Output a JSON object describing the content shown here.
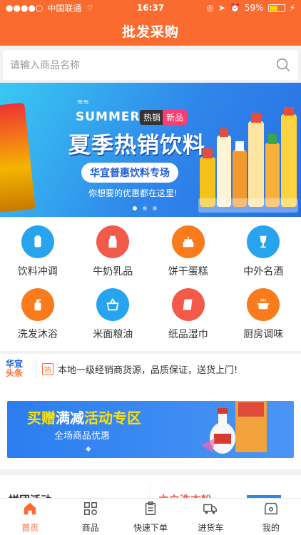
{
  "status_bar": {
    "carrier": "中国联通",
    "time": "16:37",
    "battery": "59%",
    "battery_level": 0.59
  },
  "header": {
    "title": "批发采购"
  },
  "search": {
    "placeholder": "请输入商品名称"
  },
  "banner": {
    "summer": "SUMMER",
    "tag_hot": "热销",
    "tag_new": "新品",
    "headline": "夏季热销饮料",
    "pill": "华宜普惠饮料专场",
    "sub": "你想要的优惠都在这里!",
    "dots": 3,
    "active_dot": 0
  },
  "categories": [
    {
      "label": "饮料冲调",
      "icon": "can-icon",
      "color": "#28a4ef"
    },
    {
      "label": "牛奶乳品",
      "icon": "milk-icon",
      "color": "#f35a4a"
    },
    {
      "label": "饼干蛋糕",
      "icon": "cake-icon",
      "color": "#fa7b1c"
    },
    {
      "label": "中外名酒",
      "icon": "wine-glass-icon",
      "color": "#28a4ef"
    },
    {
      "label": "洗发沐浴",
      "icon": "shampoo-icon",
      "color": "#fa7b1c"
    },
    {
      "label": "米面粮油",
      "icon": "basket-icon",
      "color": "#28a4ef"
    },
    {
      "label": "纸品湿巾",
      "icon": "tissue-icon",
      "color": "#f35a4a"
    },
    {
      "label": "厨房调味",
      "icon": "pot-icon",
      "color": "#fa7b1c"
    }
  ],
  "news": {
    "logo_line1": "华宜",
    "logo_line2": "头条",
    "badge": "热",
    "text": "本地一级经销商货源，品质保证，送货上门!"
  },
  "promo": {
    "title_a": "买赠",
    "title_b": "满减",
    "title_c": "活动专区",
    "subtitle": "全场商品优惠"
  },
  "section_peek": {
    "left": "拼团活动",
    "right": "立白洗衣粉"
  },
  "tabbar": [
    {
      "label": "首页",
      "icon": "home-icon",
      "active": true
    },
    {
      "label": "商品",
      "icon": "grid-icon",
      "active": false
    },
    {
      "label": "快速下单",
      "icon": "clipboard-icon",
      "active": false
    },
    {
      "label": "进货车",
      "icon": "truck-icon",
      "active": false
    },
    {
      "label": "我的",
      "icon": "store-icon",
      "active": false
    }
  ],
  "colors": {
    "brand": "#fb6b2f",
    "blue": "#28a4ef",
    "red": "#f35a4a",
    "orange": "#fa7b1c"
  }
}
